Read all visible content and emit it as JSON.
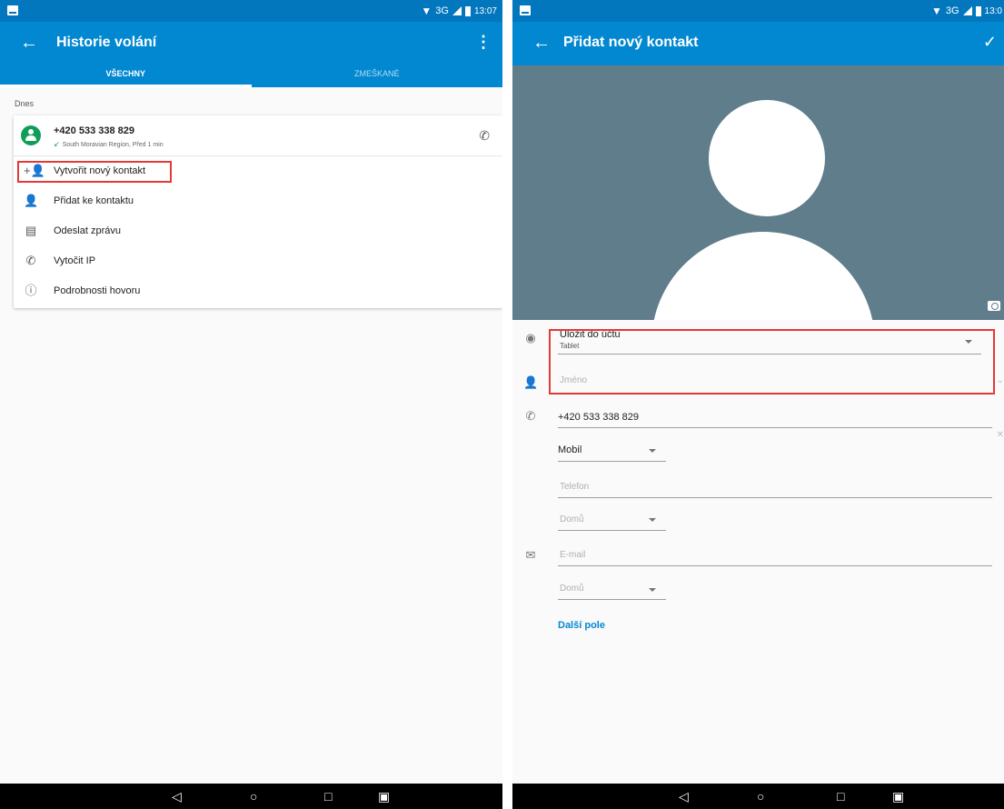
{
  "left": {
    "status": {
      "network": "3G",
      "time": "13:07"
    },
    "appbar": {
      "title": "Historie volání"
    },
    "tabs": [
      {
        "label": "VŠECHNY"
      },
      {
        "label": "ZMEŠKANÉ"
      }
    ],
    "section_label": "Dnes",
    "call": {
      "number": "+420 533 338 829",
      "detail": "South Moravian Region, Před 1 min"
    },
    "actions": [
      {
        "label": "Vytvořit nový kontakt",
        "icon": "person-add-icon"
      },
      {
        "label": "Přidat ke kontaktu",
        "icon": "person-icon"
      },
      {
        "label": "Odeslat zprávu",
        "icon": "message-icon"
      },
      {
        "label": "Vytočit IP",
        "icon": "phone-ip-icon"
      },
      {
        "label": "Podrobnosti hovoru",
        "icon": "info-icon"
      }
    ]
  },
  "right": {
    "status": {
      "network": "3G",
      "time": "13:0"
    },
    "appbar": {
      "title": "Přidat nový kontakt"
    },
    "account": {
      "label": "Uložit do účtu",
      "value": "Tablet"
    },
    "name": {
      "placeholder": "Jméno"
    },
    "phone": {
      "value": "+420 533 338 829",
      "type": "Mobil"
    },
    "phone2": {
      "placeholder": "Telefon",
      "type": "Domů"
    },
    "email": {
      "placeholder": "E-mail",
      "type": "Domů"
    },
    "more_fields": "Další pole"
  },
  "colors": {
    "appbar": "#0288d1",
    "statusbar": "#0277bd",
    "highlight": "#e53935",
    "avatar": "#0f9d58",
    "photo_bg": "#607d8b"
  }
}
